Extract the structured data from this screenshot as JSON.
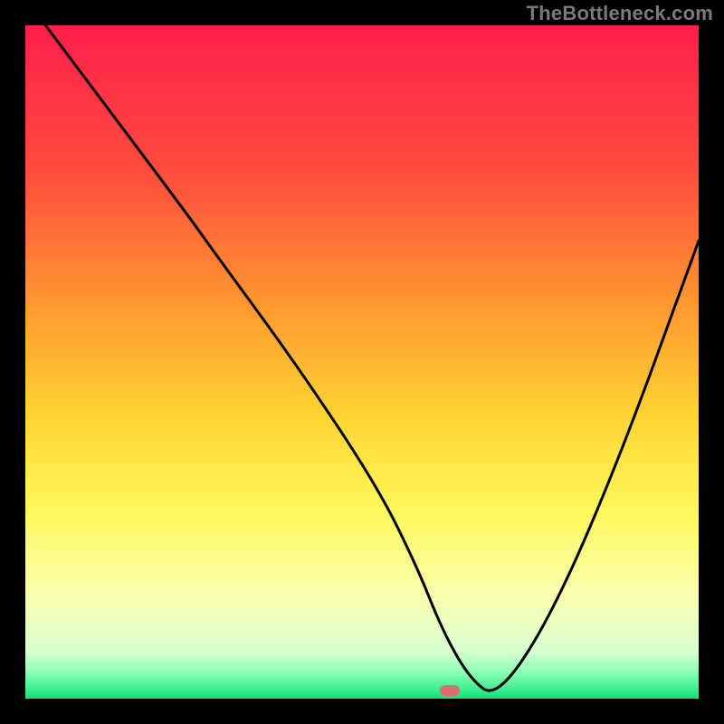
{
  "watermark": "TheBottleneck.com",
  "chart_data": {
    "type": "line",
    "title": "",
    "xlabel": "",
    "ylabel": "",
    "xlim": [
      0,
      100
    ],
    "ylim": [
      0,
      100
    ],
    "grid": false,
    "legend": false,
    "gradient_stops": [
      {
        "offset": 0.0,
        "color": "#ff1f4b"
      },
      {
        "offset": 0.22,
        "color": "#ff4d3e"
      },
      {
        "offset": 0.42,
        "color": "#ff9a2f"
      },
      {
        "offset": 0.58,
        "color": "#ffd433"
      },
      {
        "offset": 0.72,
        "color": "#fff85a"
      },
      {
        "offset": 0.85,
        "color": "#f7ffb0"
      },
      {
        "offset": 0.93,
        "color": "#d8ffd0"
      },
      {
        "offset": 0.965,
        "color": "#7fffb0"
      },
      {
        "offset": 1.0,
        "color": "#14e07a"
      }
    ],
    "series": [
      {
        "name": "bottleneck-curve",
        "x": [
          3,
          12,
          24,
          29,
          40,
          52,
          58,
          62,
          66,
          70,
          78,
          88,
          100
        ],
        "y": [
          100,
          88,
          72,
          65,
          50,
          32,
          20,
          10,
          3,
          0,
          12,
          35,
          68
        ]
      }
    ],
    "marker": {
      "x": 63,
      "y": 1.2,
      "color": "#de6e6e"
    }
  }
}
